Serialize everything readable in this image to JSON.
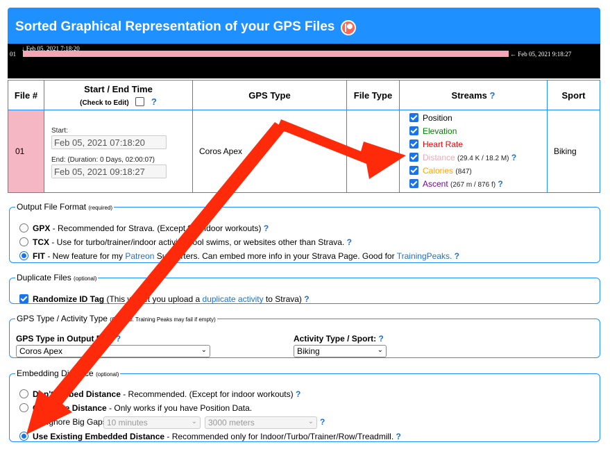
{
  "header": {
    "title": "Sorted Graphical Representation of your GPS Files"
  },
  "timeline": {
    "start_label": "↓ Feb 05, 2021 7:18:20",
    "row_label": "01",
    "end_label": "← Feb 05, 2021 9:18:27"
  },
  "table": {
    "headers": {
      "file_num": "File #",
      "time": "Start / End Time",
      "time_sub": "(Check to Edit)",
      "gps_type": "GPS Type",
      "file_type": "File Type",
      "streams": "Streams",
      "sport": "Sport"
    },
    "row": {
      "num": "01",
      "start_label": "Start:",
      "start_value": "Feb 05, 2021 07:18:20",
      "end_label": "End: (Duration: 0 Days, 02:00:07)",
      "end_value": "Feb 05, 2021 09:18:27",
      "gps_type": "Coros Apex",
      "file_type": "",
      "sport": "Biking"
    },
    "streams": [
      {
        "name": "Position",
        "color": "#000000",
        "extra": ""
      },
      {
        "name": "Elevation",
        "color": "#008000",
        "extra": ""
      },
      {
        "name": "Heart Rate",
        "color": "#ff0000",
        "extra": ""
      },
      {
        "name": "Distance",
        "color": "#f4a6b4",
        "extra": "(29.4 K / 18.2 M)"
      },
      {
        "name": "Calories",
        "color": "#ffa500",
        "extra": "(847)"
      },
      {
        "name": "Ascent",
        "color": "#8000a0",
        "extra": "(267 m / 876 f)"
      }
    ]
  },
  "output_format": {
    "legend": "Output File Format",
    "legend_note": "(required)",
    "gpx_label": "GPX",
    "gpx_desc": " - Recommended for Strava. (Except for indoor workouts)",
    "tcx_label": "TCX",
    "tcx_desc": " - Use for turbo/trainer/indoor activity, pool swims, or websites other than Strava.",
    "fit_label": "FIT",
    "fit_desc1": " - New feature for my ",
    "fit_link1": "Patreon",
    "fit_desc2": " Supporters. Can embed more info in your Strava Page. Good for ",
    "fit_link2": "TrainingPeaks."
  },
  "duplicate": {
    "legend": "Duplicate Files",
    "legend_note": "(optional)",
    "label": "Randomize ID Tag",
    "desc1": " (This will let you upload a ",
    "link": "duplicate activity",
    "desc2": " to Strava)"
  },
  "gps_activity": {
    "legend": "GPS Type / Activity Type",
    "legend_note": "(Optional. Training Peaks may fail if empty)",
    "gps_label": "GPS Type in Output File:",
    "gps_value": "Coros Apex",
    "activity_label": "Activity Type / Sport:",
    "activity_value": "Biking"
  },
  "embedding": {
    "legend": "Embedding Distance",
    "legend_note": "(optional)",
    "opt1_label": "Don't Embed Distance",
    "opt1_desc": " - Recommended. (Except for indoor workouts)",
    "opt2_label": "Calculate Distance",
    "opt2_desc": " - Only works if you have Position Data.",
    "ignore_label": "Ignore Big Gaps",
    "gap_time": "10 minutes",
    "gap_dist": "3000 meters",
    "opt3_label": "Use Existing Embedded Distance",
    "opt3_desc": " - Recommended only for Indoor/Turbo/Trainer/Row/Treadmill."
  },
  "help_mark": "?",
  "colors": {
    "accent": "#1e90ff",
    "arrow": "#ff2a0a"
  }
}
